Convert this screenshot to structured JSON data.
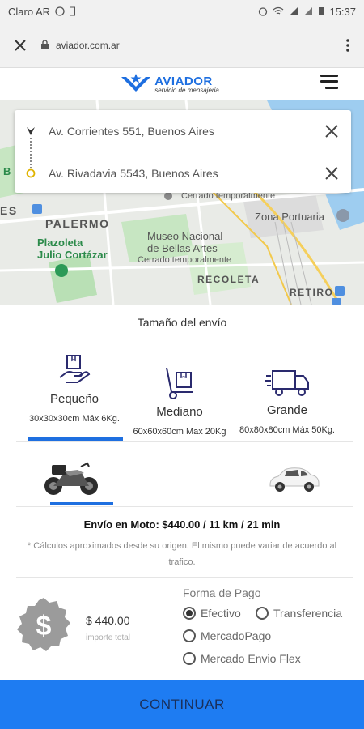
{
  "status_bar": {
    "carrier": "Claro AR",
    "time": "15:37"
  },
  "browser": {
    "url": "aviador.com.ar"
  },
  "app": {
    "brand_name": "AVIADOR",
    "brand_tagline": "servicio de mensajeria"
  },
  "map": {
    "labels": [
      "PALERMO",
      "Plazoleta",
      "Julio Cortázar",
      "Museo Nacional",
      "de Bellas Artes",
      "Cerrado temporalmente",
      "Cerrado temporalmente",
      "Zona Portuaria",
      "RECOLETA",
      "RETIRO",
      "ES",
      "B"
    ]
  },
  "route": {
    "origin": "Av. Corrientes 551, Buenos Aires",
    "destination": "Av. Rivadavia 5543, Buenos Aires"
  },
  "size_section": {
    "title": "Tamaño del envío",
    "options": [
      {
        "name": "Pequeño",
        "dims": "30x30x30cm Máx 6Kg.",
        "selected": true
      },
      {
        "name": "Mediano",
        "dims": "60x60x60cm Max 20Kg",
        "selected": false
      },
      {
        "name": "Grande",
        "dims": "80x80x80cm Máx 50Kg.",
        "selected": false
      }
    ]
  },
  "vehicles": [
    {
      "name": "moto",
      "selected": true
    },
    {
      "name": "auto",
      "selected": false
    }
  ],
  "summary": {
    "text": "Envío en Moto: $440.00 / 11 km / 21 min",
    "disclaimer": "* Cálculos aproximados desde su origen. El mismo puede variar de acuerdo al trafico."
  },
  "price": {
    "symbol": "$",
    "amount": "$ 440.00",
    "caption": "importe total"
  },
  "payment": {
    "title": "Forma de Pago",
    "options": [
      {
        "label": "Efectivo",
        "checked": true
      },
      {
        "label": "Transferencia",
        "checked": false
      },
      {
        "label": "MercadoPago",
        "checked": false
      },
      {
        "label": "Mercado Envio Flex",
        "checked": false
      }
    ]
  },
  "actions": {
    "continue_label": "CONTINUAR"
  },
  "colors": {
    "accent": "#1e7cf2",
    "brand": "#1e6fe0"
  }
}
